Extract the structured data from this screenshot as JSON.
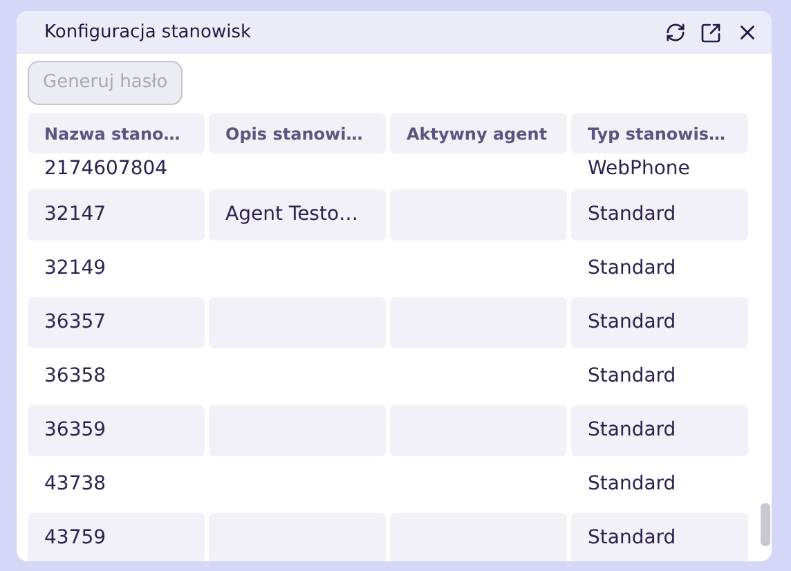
{
  "window": {
    "title": "Konfiguracja stanowisk"
  },
  "toolbar": {
    "button": {
      "label": "Generuj hasło",
      "disabled": true
    }
  },
  "table": {
    "columns": [
      "Nazwa stano…",
      "Opis stanowi…",
      "Aktywny agent",
      "Typ stanowis…"
    ],
    "rows": [
      {
        "cells": [
          "2174607804",
          "",
          "",
          "WebPhone"
        ]
      },
      {
        "cells": [
          "32147",
          "Agent Testo…",
          "",
          "Standard"
        ]
      },
      {
        "cells": [
          "32149",
          "",
          "",
          "Standard"
        ]
      },
      {
        "cells": [
          "36357",
          "",
          "",
          "Standard"
        ]
      },
      {
        "cells": [
          "36358",
          "",
          "",
          "Standard"
        ]
      },
      {
        "cells": [
          "36359",
          "",
          "",
          "Standard"
        ]
      },
      {
        "cells": [
          "43738",
          "",
          "",
          "Standard"
        ]
      },
      {
        "cells": [
          "43759",
          "",
          "",
          "Standard"
        ]
      }
    ]
  }
}
